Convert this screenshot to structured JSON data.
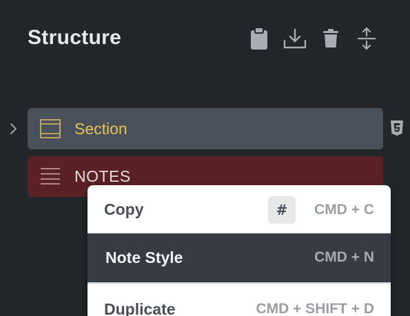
{
  "panel": {
    "title": "Structure",
    "toolbar": {
      "paste": "clipboard-icon",
      "download": "download-icon",
      "delete": "trash-icon",
      "collapse": "expand-collapse-icon"
    }
  },
  "tree": {
    "section": {
      "label": "Section",
      "color": "#e4c45a",
      "badge_icon": "css3-icon"
    },
    "notes": {
      "label": "NOTES",
      "color": "#5b2226"
    }
  },
  "context_menu": {
    "items": [
      {
        "label": "Copy",
        "key_badge": "#",
        "shortcut": "CMD + C"
      },
      {
        "label": "Note Style",
        "shortcut": "CMD + N",
        "highlighted": true
      },
      {
        "label": "Duplicate",
        "shortcut": "CMD + SHIFT + D"
      }
    ]
  }
}
